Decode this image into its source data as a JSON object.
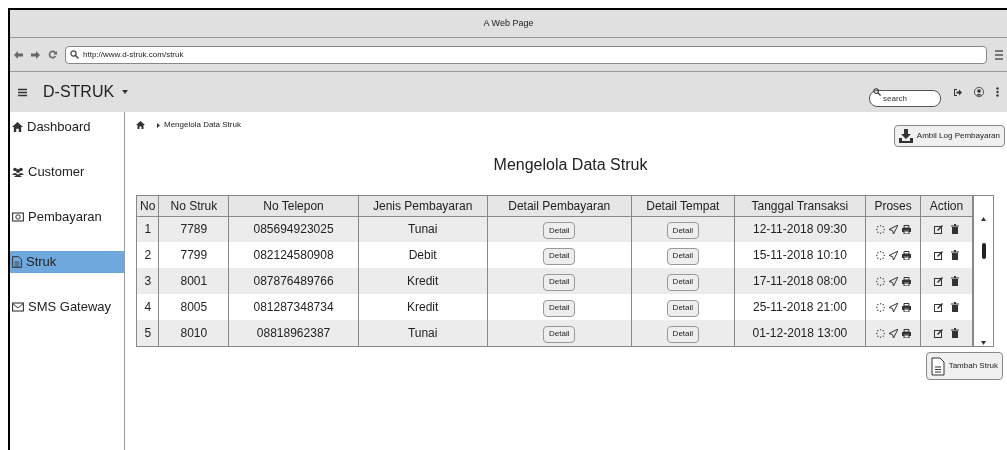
{
  "window": {
    "title": "A Web Page"
  },
  "browser": {
    "url": "http://www.d-struk.com/struk"
  },
  "app": {
    "brand": "D-STRUK",
    "search": {
      "placeholder": "search"
    }
  },
  "sidebar": {
    "items": [
      {
        "label": "Dashboard",
        "selected": false
      },
      {
        "label": "Customer",
        "selected": false
      },
      {
        "label": "Pembayaran",
        "selected": false
      },
      {
        "label": "Struk",
        "selected": true
      },
      {
        "label": "SMS Gateway",
        "selected": false
      }
    ]
  },
  "breadcrumb": "Mengelola Data Struk",
  "log_button": "Ambil Log Pembayaran",
  "page_title": "Mengelola Data Struk",
  "table": {
    "columns": [
      "No",
      "No Struk",
      "No Telepon",
      "Jenis Pembayaran",
      "Detail Pembayaran",
      "Detail Tempat",
      "Tanggal Transaksi",
      "Proses",
      "Action"
    ],
    "rows": [
      {
        "no": "1",
        "struk": "7789",
        "phone": "085694923025",
        "type": "Tunai",
        "detail_payment": "Detail",
        "detail_place": "Detail",
        "date": "12-11-2018 09:30"
      },
      {
        "no": "2",
        "struk": "7799",
        "phone": "082124580908",
        "type": "Debit",
        "detail_payment": "Detail",
        "detail_place": "Detail",
        "date": "15-11-2018 10:10"
      },
      {
        "no": "3",
        "struk": "8001",
        "phone": "087876489766",
        "type": "Kredit",
        "detail_payment": "Detail",
        "detail_place": "Detail",
        "date": "17-11-2018 08:00"
      },
      {
        "no": "4",
        "struk": "8005",
        "phone": "081287348734",
        "type": "Kredit",
        "detail_payment": "Detail",
        "detail_place": "Detail",
        "date": "25-11-2018 21:00"
      },
      {
        "no": "5",
        "struk": "8010",
        "phone": "08818962387",
        "type": "Tunai",
        "detail_payment": "Detail",
        "detail_place": "Detail",
        "date": "01-12-2018 13:00"
      }
    ]
  },
  "add_button": "Tambah Struk"
}
